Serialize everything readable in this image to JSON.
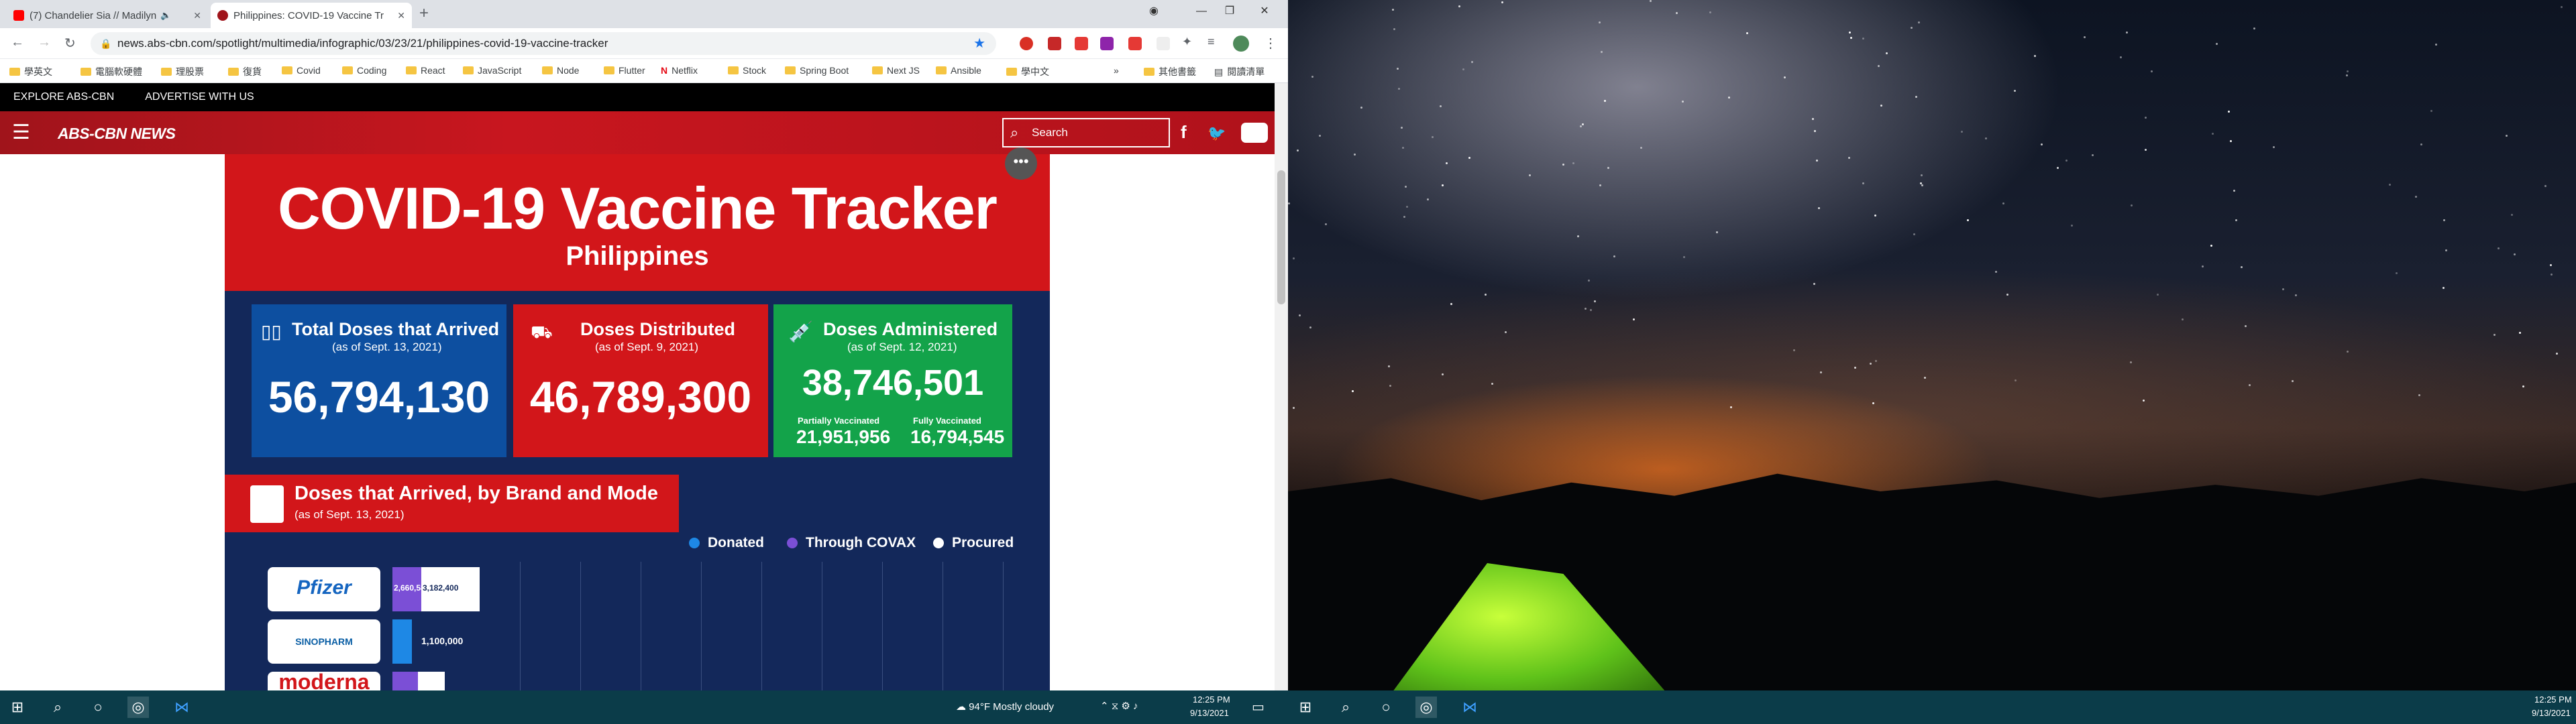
{
  "browser": {
    "tabs": [
      {
        "label": "(7) Chandelier Sia // Madilyn"
      },
      {
        "label": "Philippines: COVID-19 Vaccine Tr"
      }
    ],
    "url": "news.abs-cbn.com/spotlight/multimedia/infographic/03/23/21/philippines-covid-19-vaccine-tracker",
    "bookmarks": [
      "學英文",
      "電腦軟硬體",
      "理股票",
      "復貨",
      "Covid",
      "Coding",
      "React",
      "JavaScript",
      "Node",
      "Flutter",
      "Netflix",
      "Stock",
      "Spring Boot",
      "Next JS",
      "Ansible",
      "學中文"
    ],
    "bookmarks_more": "»",
    "other_bookmarks": "其他書籤",
    "reading_list": "閱讀清單"
  },
  "site": {
    "top_links": [
      "EXPLORE ABS-CBN",
      "ADVERTISE WITH US"
    ],
    "brand": "ABS-CBN NEWS",
    "search_placeholder": "Search"
  },
  "infographic": {
    "title": "COVID-19 Vaccine Tracker",
    "subtitle": "Philippines",
    "cards": [
      {
        "title": "Total Doses that Arrived",
        "asof": "(as of Sept. 13, 2021)",
        "value": "56,794,130",
        "color": "#0d4fa0"
      },
      {
        "title": "Doses Distributed",
        "asof": "(as of Sept. 9, 2021)",
        "value": "46,789,300",
        "color": "#d2161a"
      },
      {
        "title": "Doses Administered",
        "asof": "(as of Sept. 12, 2021)",
        "value": "38,746,501",
        "color": "#13a34a"
      }
    ],
    "partial_label": "Partially Vaccinated",
    "partial_value": "21,951,956",
    "full_label": "Fully Vaccinated",
    "full_value": "16,794,545",
    "brand_section_title": "Doses that Arrived, by Brand and Mode",
    "brand_section_asof": "(as of Sept. 13, 2021)",
    "legend": [
      {
        "label": "Donated",
        "color": "#1e88e5"
      },
      {
        "label": "Through COVAX",
        "color": "#7b4fd6"
      },
      {
        "label": "Procured",
        "color": "#ffffff"
      }
    ],
    "brands": [
      {
        "name": "Pfizer",
        "covax": 2660580,
        "procured": 3182400,
        "covax_label": "2,660,580",
        "procured_label": "3,182,400"
      },
      {
        "name": "SINOPHARM",
        "donated": 1100000,
        "donated_label": "1,100,000"
      },
      {
        "name": "moderna"
      }
    ]
  },
  "taskbar": {
    "weather": "94°F  Mostly cloudy",
    "time": "12:25 PM",
    "date": "9/13/2021"
  }
}
